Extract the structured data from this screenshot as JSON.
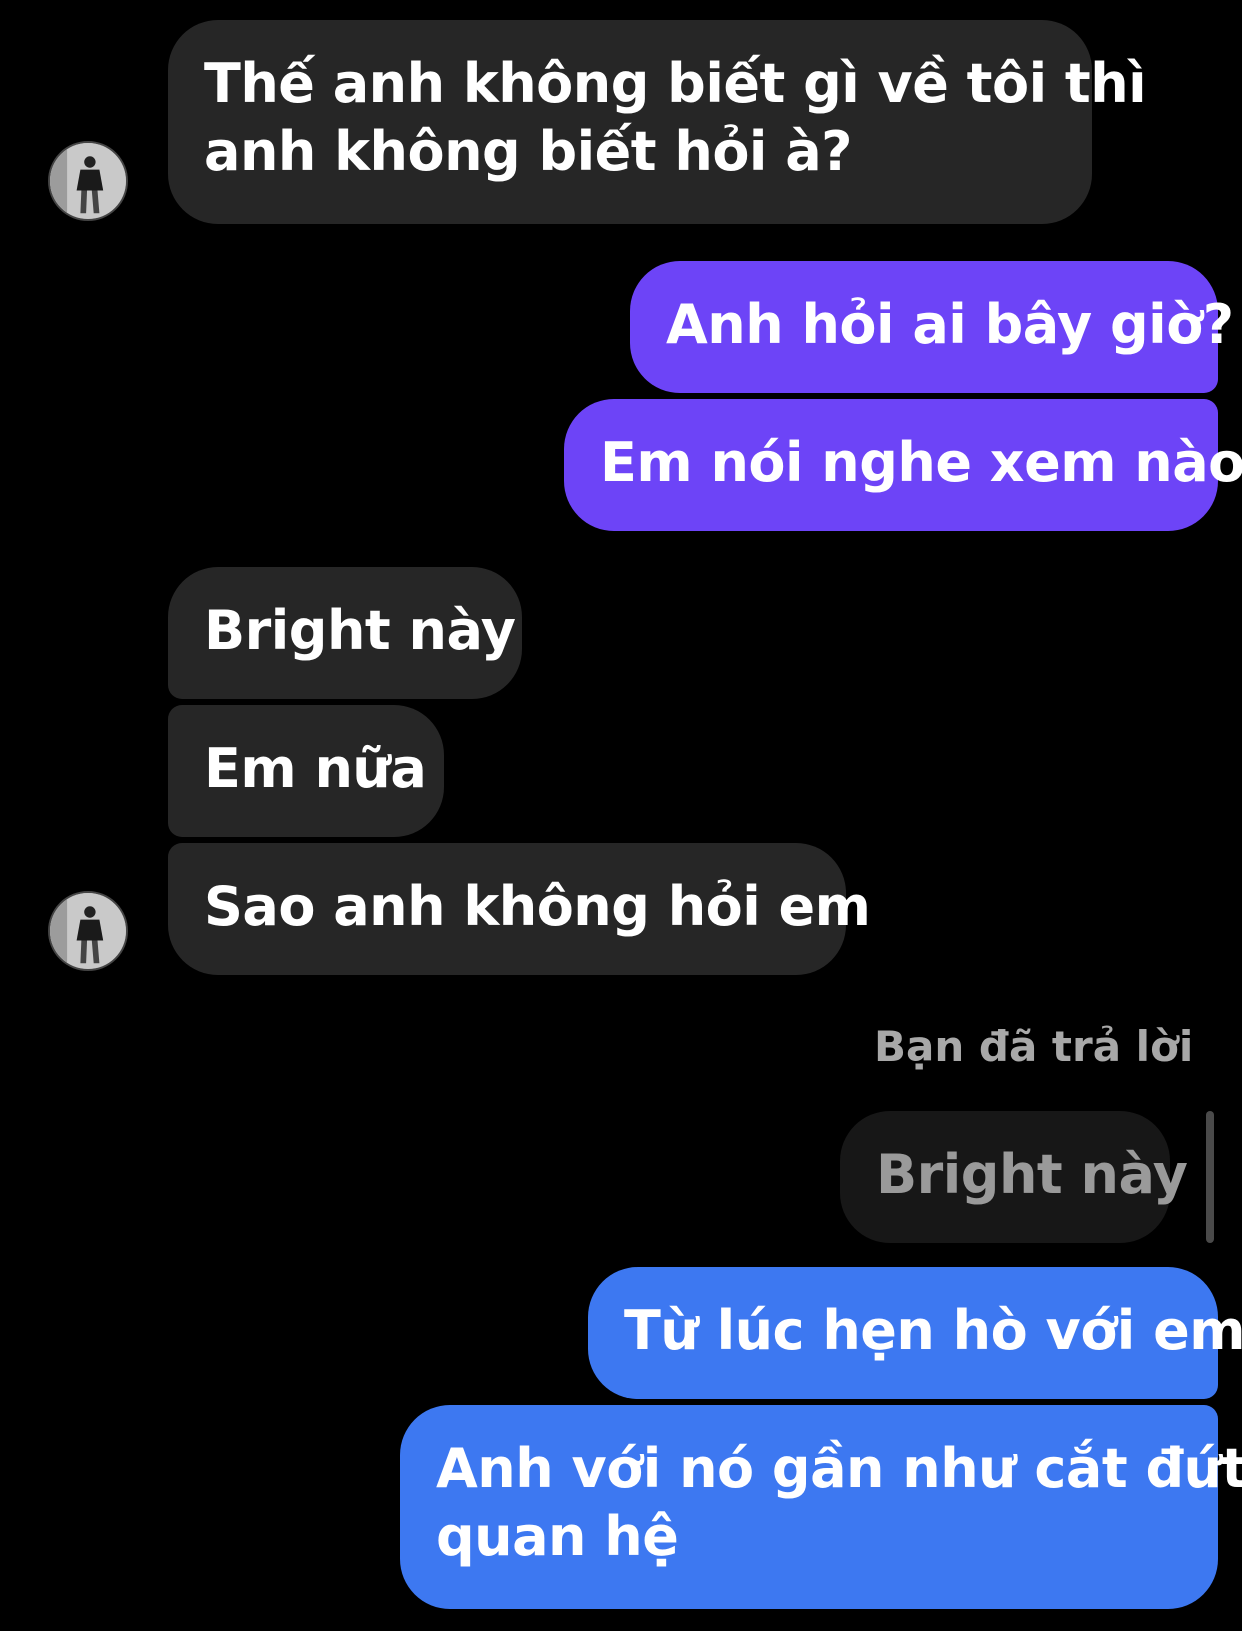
{
  "messages": {
    "m1": "Thế anh không biết gì về tôi thì anh không biết hỏi à?",
    "m1_line1": "Thế anh không biết gì về tôi thì",
    "m1_line2": "anh không biết hỏi à?",
    "m2": "Anh hỏi ai bây giờ?",
    "m3": "Em nói nghe xem nào",
    "m4": "Bright này",
    "m5": "Em nữa",
    "m6": "Sao anh không hỏi em",
    "reply_label": "Bạn đã trả lời",
    "reply_quote": "Bright này",
    "m7": "Từ lúc hẹn hò với em",
    "m8_line1": "Anh với nó gần như cắt đứt",
    "m8_line2": "quan hệ"
  },
  "colors": {
    "background": "#000000",
    "incoming_bubble": "#262626",
    "outgoing_purple": "#6d44f7",
    "outgoing_blue": "#3d78f1",
    "reply_quote_bubble": "#171717"
  }
}
